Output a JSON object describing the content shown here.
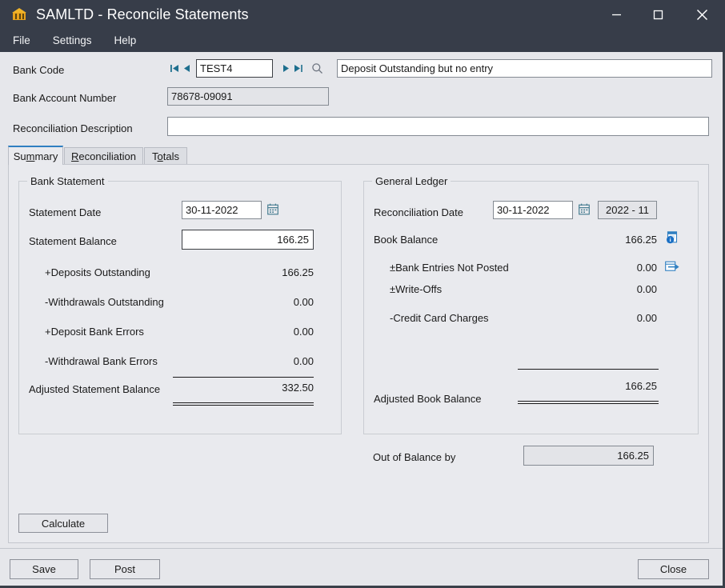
{
  "window": {
    "title": "SAMLTD - Reconcile Statements",
    "app_icon": "bank-icon",
    "controls": {
      "minimize": "minimize-icon",
      "maximize": "maximize-icon",
      "close": "close-icon"
    }
  },
  "menubar": {
    "items": [
      {
        "label": "File"
      },
      {
        "label": "Settings"
      },
      {
        "label": "Help"
      }
    ]
  },
  "header": {
    "bank_code": {
      "label": "Bank Code",
      "value": "TEST4",
      "nav": {
        "first": "first-record-icon",
        "prev": "previous-record-icon",
        "next": "next-record-icon",
        "last": "last-record-icon",
        "find": "search-icon"
      },
      "description": "Deposit Outstanding but no entry"
    },
    "bank_account_number": {
      "label": "Bank Account Number",
      "value": "78678-09091"
    },
    "reconciliation_description": {
      "label": "Reconciliation Description",
      "value": "",
      "placeholder": ""
    }
  },
  "tabs": [
    {
      "label": "Summary",
      "mnemonic": "m",
      "active": true
    },
    {
      "label": "Reconciliation",
      "mnemonic": "R",
      "active": false
    },
    {
      "label": "Totals",
      "mnemonic": "t",
      "active": false
    }
  ],
  "bank_statement": {
    "title": "Bank Statement",
    "statement_date": {
      "label": "Statement Date",
      "value": "30-11-2022",
      "icon": "calendar-icon"
    },
    "statement_balance": {
      "label": "Statement Balance",
      "value": "166.25"
    },
    "rows": [
      {
        "label": "+Deposits Outstanding",
        "value": "166.25"
      },
      {
        "label": "-Withdrawals Outstanding",
        "value": "0.00"
      },
      {
        "label": "+Deposit Bank Errors",
        "value": "0.00"
      },
      {
        "label": "-Withdrawal Bank Errors",
        "value": "0.00"
      }
    ],
    "adjusted": {
      "label": "Adjusted Statement Balance",
      "value": "332.50"
    }
  },
  "general_ledger": {
    "title": "General Ledger",
    "reconciliation_date": {
      "label": "Reconciliation Date",
      "value": "30-11-2022",
      "icon": "calendar-icon"
    },
    "period": {
      "value": "2022 - 11"
    },
    "book_balance": {
      "label": "Book Balance",
      "value": "166.25",
      "icon": "book-balance-drilldown-icon"
    },
    "rows": [
      {
        "label": "±Bank Entries Not Posted",
        "value": "0.00",
        "icon": "bank-entries-drilldown-icon"
      },
      {
        "label": "±Write-Offs",
        "value": "0.00"
      },
      {
        "label": "-Credit Card Charges",
        "value": "0.00"
      }
    ],
    "adjusted": {
      "label": "Adjusted Book Balance",
      "value": "166.25"
    }
  },
  "out_of_balance": {
    "label": "Out of Balance by",
    "value": "166.25"
  },
  "buttons": {
    "calculate": "Calculate",
    "save": "Save",
    "post": "Post",
    "close": "Close"
  },
  "colors": {
    "titlebar": "#373d49",
    "accent": "#2f7fc1",
    "nav_arrow": "#1e6f8e",
    "page_bg": "#e6e7eb"
  }
}
